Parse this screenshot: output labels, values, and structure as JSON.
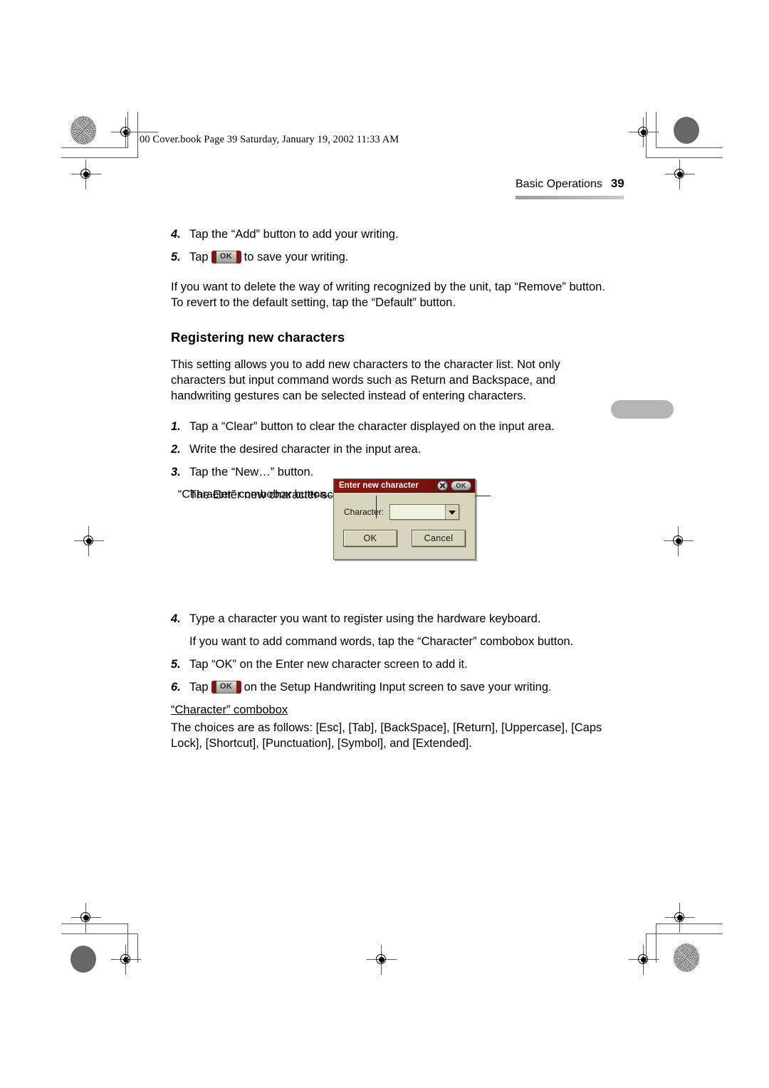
{
  "print_header": {
    "book_label": "00 Cover.book  Page 39  Saturday, January 19, 2002  11:33 AM"
  },
  "running_head": {
    "chapter": "Basic Operations",
    "page_number": "39"
  },
  "body": {
    "steps_top": [
      {
        "num": "4.",
        "text": "Tap the “Add” button to add your writing."
      }
    ],
    "step5": {
      "num": "5.",
      "before": "Tap",
      "key_label": "OK",
      "after": "to save your writing."
    },
    "note_paragraph": "If you want to delete the way of writing recognized by the unit, tap “Remove” button. To revert to the default setting, tap the “Default” button.",
    "section_title": "Registering new characters",
    "intro_paragraph": "This setting allows you to add new characters to the character list. Not only characters but input command words such as Return and Backspace, and handwriting gestures can be selected instead of entering characters.",
    "steps_middle": [
      {
        "num": "1.",
        "text": "Tap a “Clear” button to clear the character displayed on the input area."
      },
      {
        "num": "2.",
        "text": "Write the desired character in the input area."
      },
      {
        "num": "3.",
        "text": "Tap the “New…” button."
      }
    ],
    "after_step3": "The Enter new character screen will be displayed.",
    "steps_bottom": [
      {
        "num": "4.",
        "text": "Type a character you want to register using the hardware keyboard."
      }
    ],
    "after_step4": "If you want to add command words, tap the “Character” combobox button.",
    "step5_bottom": {
      "num": "5.",
      "text": "Tap “OK” on the Enter new character screen to add it."
    },
    "step6_bottom": {
      "num": "6.",
      "before": "Tap",
      "key_label": "OK",
      "after": "on the Setup Handwriting Input screen to save your writing."
    },
    "combobox_heading": "“Character” combobox",
    "combobox_choices_paragraph": "The choices are as follows: [Esc], [Tab], [BackSpace], [Return], [Uppercase], [Caps Lock], [Shortcut], [Punctuation], [Symbol], and [Extended]."
  },
  "figure": {
    "callout_label": "“Character” combobox button",
    "dialog": {
      "title": "Enter new character",
      "close_icon": "close-x-icon",
      "titlebar_ok_label": "OK",
      "field_label": "Character:",
      "field_value": "",
      "dropdown_icon": "chevron-down-icon",
      "ok_label": "OK",
      "cancel_label": "Cancel"
    }
  },
  "colors": {
    "titlebar_red": "#7c1410",
    "dialog_face": "#d8d5be",
    "combobox_field": "#eef0e0",
    "thumb_tab_gray": "#b4b4b4"
  }
}
